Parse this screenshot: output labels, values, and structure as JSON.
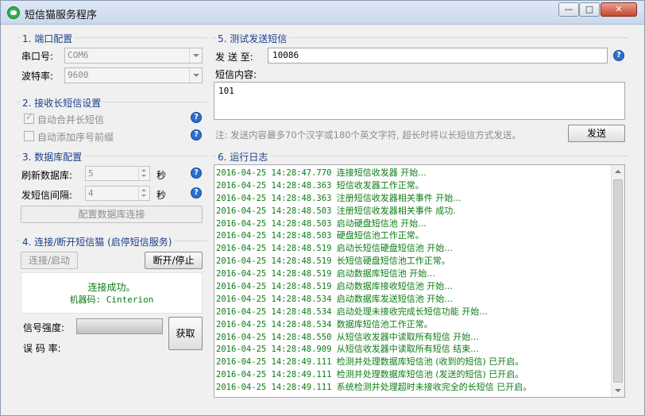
{
  "window": {
    "title": "短信猫服务程序",
    "min_label": "—",
    "max_label": "□",
    "close_label": "✕"
  },
  "port": {
    "title": "1. 端口配置",
    "serial_label": "串口号:",
    "serial_value": "COM6",
    "baud_label": "波特率:",
    "baud_value": "9600"
  },
  "long_sms": {
    "title": "2. 接收长短信设置",
    "merge_label": "自动合并长短信",
    "merge_checked": true,
    "seq_label": "自动添加序号前缀",
    "seq_checked": false
  },
  "database": {
    "title": "3. 数据库配置",
    "refresh_label": "刷新数据库:",
    "refresh_value": "5",
    "refresh_unit": "秒",
    "send_label": "发短信间隔:",
    "send_value": "4",
    "send_unit": "秒",
    "config_button": "配置数据库连接"
  },
  "connect": {
    "title": "4. 连接/断开短信猫 (启停短信服务)",
    "connect_button": "连接/启动",
    "disconnect_button": "断开/停止",
    "status_text": "连接成功。",
    "model_text": "机器码: Cinterion",
    "signal_label": "信号强度:",
    "error_label": "误 码 率:",
    "get_button": "获取"
  },
  "test": {
    "title": "5. 测试发送短信",
    "to_label": "发 送 至:",
    "to_value": "10086",
    "content_label": "短信内容:",
    "content_value": "101",
    "note": "注: 发送内容最多70个汉字或180个英文字符, 超长时将以长短信方式发送。",
    "send_button": "发送"
  },
  "log": {
    "title": "6. 运行日志",
    "lines": [
      {
        "time": "2016-04-25 14:28:47.770",
        "msg": "连接短信收发器 开始..."
      },
      {
        "time": "2016-04-25 14:28:48.363",
        "msg": "短信收发器工作正常。"
      },
      {
        "time": "2016-04-25 14:28:48.363",
        "msg": "注册短信收发器相关事件 开始..."
      },
      {
        "time": "2016-04-25 14:28:48.503",
        "msg": "注册短信收发器相关事件 成功."
      },
      {
        "time": "2016-04-25 14:28:48.503",
        "msg": "启动硬盘短信池 开始..."
      },
      {
        "time": "2016-04-25 14:28:48.503",
        "msg": "硬盘短信池工作正常。"
      },
      {
        "time": "2016-04-25 14:28:48.519",
        "msg": "启动长短信硬盘短信池 开始..."
      },
      {
        "time": "2016-04-25 14:28:48.519",
        "msg": "长短信硬盘短信池工作正常。"
      },
      {
        "time": "2016-04-25 14:28:48.519",
        "msg": "启动数据库短信池 开始..."
      },
      {
        "time": "2016-04-25 14:28:48.519",
        "msg": "启动数据库接收短信池 开始..."
      },
      {
        "time": "2016-04-25 14:28:48.534",
        "msg": "启动数据库发送短信池 开始..."
      },
      {
        "time": "2016-04-25 14:28:48.534",
        "msg": "启动处理未接收完成长短信功能 开始..."
      },
      {
        "time": "2016-04-25 14:28:48.534",
        "msg": "数据库短信池工作正常。"
      },
      {
        "time": "2016-04-25 14:28:48.550",
        "msg": "从短信收发器中读取所有短信 开始..."
      },
      {
        "time": "2016-04-25 14:28:48.909",
        "msg": "从短信收发器中读取所有短信 结束..."
      },
      {
        "time": "2016-04-25 14:28:49.111",
        "msg": "检测并处理数据库短信池 (收到的短信) 已开启。"
      },
      {
        "time": "2016-04-25 14:28:49.111",
        "msg": "检测并处理数据库短信池 (发送的短信) 已开启。"
      },
      {
        "time": "2016-04-25 14:28:49.111",
        "msg": "系统检测并处理超时未接收完全的长短信 已开启。"
      }
    ]
  }
}
